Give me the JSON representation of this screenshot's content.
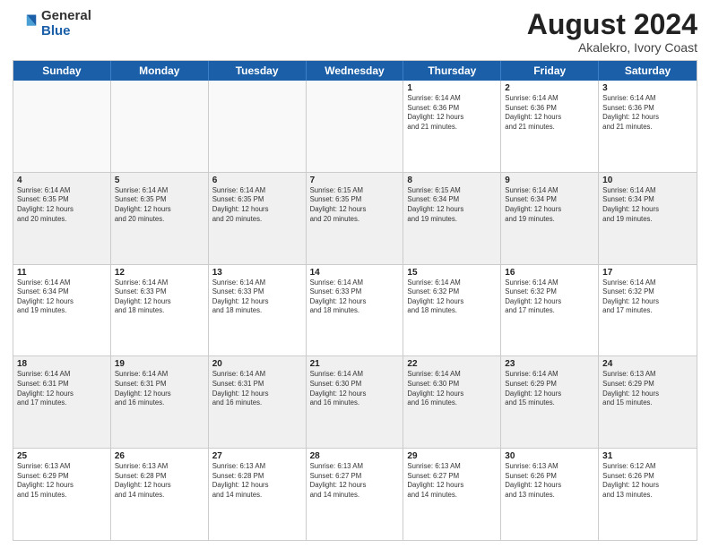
{
  "header": {
    "logo_general": "General",
    "logo_blue": "Blue",
    "month_year": "August 2024",
    "location": "Akalekro, Ivory Coast"
  },
  "days_of_week": [
    "Sunday",
    "Monday",
    "Tuesday",
    "Wednesday",
    "Thursday",
    "Friday",
    "Saturday"
  ],
  "rows": [
    [
      {
        "day": "",
        "info": "",
        "empty": true
      },
      {
        "day": "",
        "info": "",
        "empty": true
      },
      {
        "day": "",
        "info": "",
        "empty": true
      },
      {
        "day": "",
        "info": "",
        "empty": true
      },
      {
        "day": "1",
        "info": "Sunrise: 6:14 AM\nSunset: 6:36 PM\nDaylight: 12 hours\nand 21 minutes."
      },
      {
        "day": "2",
        "info": "Sunrise: 6:14 AM\nSunset: 6:36 PM\nDaylight: 12 hours\nand 21 minutes."
      },
      {
        "day": "3",
        "info": "Sunrise: 6:14 AM\nSunset: 6:36 PM\nDaylight: 12 hours\nand 21 minutes."
      }
    ],
    [
      {
        "day": "4",
        "info": "Sunrise: 6:14 AM\nSunset: 6:35 PM\nDaylight: 12 hours\nand 20 minutes."
      },
      {
        "day": "5",
        "info": "Sunrise: 6:14 AM\nSunset: 6:35 PM\nDaylight: 12 hours\nand 20 minutes."
      },
      {
        "day": "6",
        "info": "Sunrise: 6:14 AM\nSunset: 6:35 PM\nDaylight: 12 hours\nand 20 minutes."
      },
      {
        "day": "7",
        "info": "Sunrise: 6:15 AM\nSunset: 6:35 PM\nDaylight: 12 hours\nand 20 minutes."
      },
      {
        "day": "8",
        "info": "Sunrise: 6:15 AM\nSunset: 6:34 PM\nDaylight: 12 hours\nand 19 minutes."
      },
      {
        "day": "9",
        "info": "Sunrise: 6:14 AM\nSunset: 6:34 PM\nDaylight: 12 hours\nand 19 minutes."
      },
      {
        "day": "10",
        "info": "Sunrise: 6:14 AM\nSunset: 6:34 PM\nDaylight: 12 hours\nand 19 minutes."
      }
    ],
    [
      {
        "day": "11",
        "info": "Sunrise: 6:14 AM\nSunset: 6:34 PM\nDaylight: 12 hours\nand 19 minutes."
      },
      {
        "day": "12",
        "info": "Sunrise: 6:14 AM\nSunset: 6:33 PM\nDaylight: 12 hours\nand 18 minutes."
      },
      {
        "day": "13",
        "info": "Sunrise: 6:14 AM\nSunset: 6:33 PM\nDaylight: 12 hours\nand 18 minutes."
      },
      {
        "day": "14",
        "info": "Sunrise: 6:14 AM\nSunset: 6:33 PM\nDaylight: 12 hours\nand 18 minutes."
      },
      {
        "day": "15",
        "info": "Sunrise: 6:14 AM\nSunset: 6:32 PM\nDaylight: 12 hours\nand 18 minutes."
      },
      {
        "day": "16",
        "info": "Sunrise: 6:14 AM\nSunset: 6:32 PM\nDaylight: 12 hours\nand 17 minutes."
      },
      {
        "day": "17",
        "info": "Sunrise: 6:14 AM\nSunset: 6:32 PM\nDaylight: 12 hours\nand 17 minutes."
      }
    ],
    [
      {
        "day": "18",
        "info": "Sunrise: 6:14 AM\nSunset: 6:31 PM\nDaylight: 12 hours\nand 17 minutes."
      },
      {
        "day": "19",
        "info": "Sunrise: 6:14 AM\nSunset: 6:31 PM\nDaylight: 12 hours\nand 16 minutes."
      },
      {
        "day": "20",
        "info": "Sunrise: 6:14 AM\nSunset: 6:31 PM\nDaylight: 12 hours\nand 16 minutes."
      },
      {
        "day": "21",
        "info": "Sunrise: 6:14 AM\nSunset: 6:30 PM\nDaylight: 12 hours\nand 16 minutes."
      },
      {
        "day": "22",
        "info": "Sunrise: 6:14 AM\nSunset: 6:30 PM\nDaylight: 12 hours\nand 16 minutes."
      },
      {
        "day": "23",
        "info": "Sunrise: 6:14 AM\nSunset: 6:29 PM\nDaylight: 12 hours\nand 15 minutes."
      },
      {
        "day": "24",
        "info": "Sunrise: 6:13 AM\nSunset: 6:29 PM\nDaylight: 12 hours\nand 15 minutes."
      }
    ],
    [
      {
        "day": "25",
        "info": "Sunrise: 6:13 AM\nSunset: 6:29 PM\nDaylight: 12 hours\nand 15 minutes."
      },
      {
        "day": "26",
        "info": "Sunrise: 6:13 AM\nSunset: 6:28 PM\nDaylight: 12 hours\nand 14 minutes."
      },
      {
        "day": "27",
        "info": "Sunrise: 6:13 AM\nSunset: 6:28 PM\nDaylight: 12 hours\nand 14 minutes."
      },
      {
        "day": "28",
        "info": "Sunrise: 6:13 AM\nSunset: 6:27 PM\nDaylight: 12 hours\nand 14 minutes."
      },
      {
        "day": "29",
        "info": "Sunrise: 6:13 AM\nSunset: 6:27 PM\nDaylight: 12 hours\nand 14 minutes."
      },
      {
        "day": "30",
        "info": "Sunrise: 6:13 AM\nSunset: 6:26 PM\nDaylight: 12 hours\nand 13 minutes."
      },
      {
        "day": "31",
        "info": "Sunrise: 6:12 AM\nSunset: 6:26 PM\nDaylight: 12 hours\nand 13 minutes."
      }
    ]
  ]
}
